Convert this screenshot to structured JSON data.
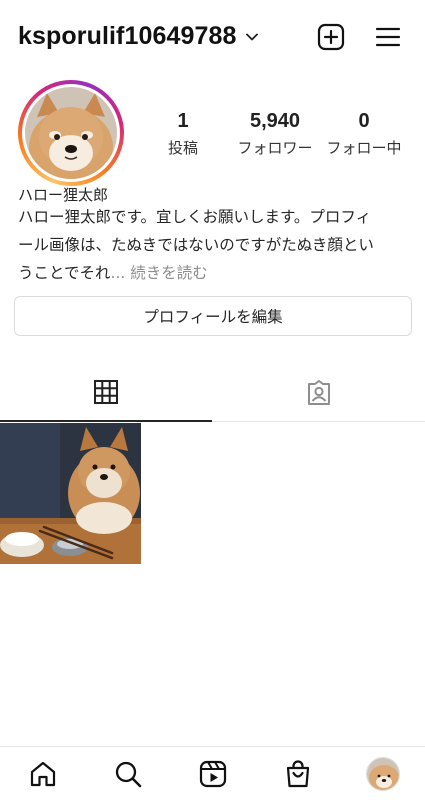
{
  "header": {
    "username": "ksporulif10649788",
    "icons": [
      "chevron-down-icon",
      "new-post-icon",
      "menu-icon"
    ]
  },
  "profile": {
    "stats": [
      {
        "value": "1",
        "label": "投稿"
      },
      {
        "value": "5,940",
        "label": "フォロワー"
      },
      {
        "value": "0",
        "label": "フォロー中"
      }
    ],
    "display_name": "ハロー狸太郎",
    "bio_line1": "ハロー狸太郎です。宜しくお願いします。プロフィ",
    "bio_line2": "ール画像は、たぬきではないのですがたぬき顔とい",
    "bio_line3": "うことでそれ",
    "bio_more": "... 続きを読む",
    "edit_button": "プロフィールを編集"
  },
  "tabs": {
    "icons": [
      "grid-icon",
      "tagged-icon"
    ],
    "active": "grid"
  },
  "bottom_nav": {
    "icons": [
      "home-icon",
      "search-icon",
      "reels-icon",
      "shop-icon",
      "profile-avatar"
    ]
  },
  "colors": {
    "ring_start": "#fdc468",
    "ring_end": "#962fbf",
    "text": "#262626",
    "muted": "#8e8e8e",
    "border": "#dbdbdb"
  }
}
